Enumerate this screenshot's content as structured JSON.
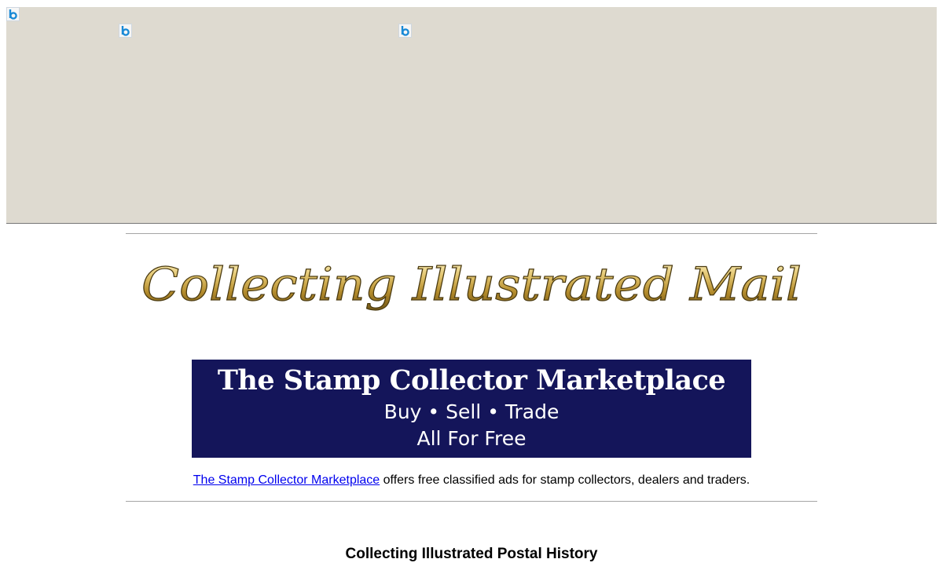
{
  "site": {
    "title": "Collecting Illustrated Mail"
  },
  "banner": {
    "title": "The Stamp Collector Marketplace",
    "line1": "Buy • Sell • Trade",
    "line2": "All For Free"
  },
  "promo": {
    "link_text": "The Stamp Collector Marketplace",
    "rest_text": " offers free classified ads for stamp collectors, dealers and traders."
  },
  "section": {
    "heading": "Collecting Illustrated Postal History"
  },
  "ad": {
    "badge_icon": "ad-choices-icon",
    "accent_color": "#1a8ad6",
    "background_color": "#dedad0"
  },
  "colors": {
    "title_gold": "#c9a64a",
    "banner_navy": "#14155a",
    "link_blue": "#0000ee"
  }
}
